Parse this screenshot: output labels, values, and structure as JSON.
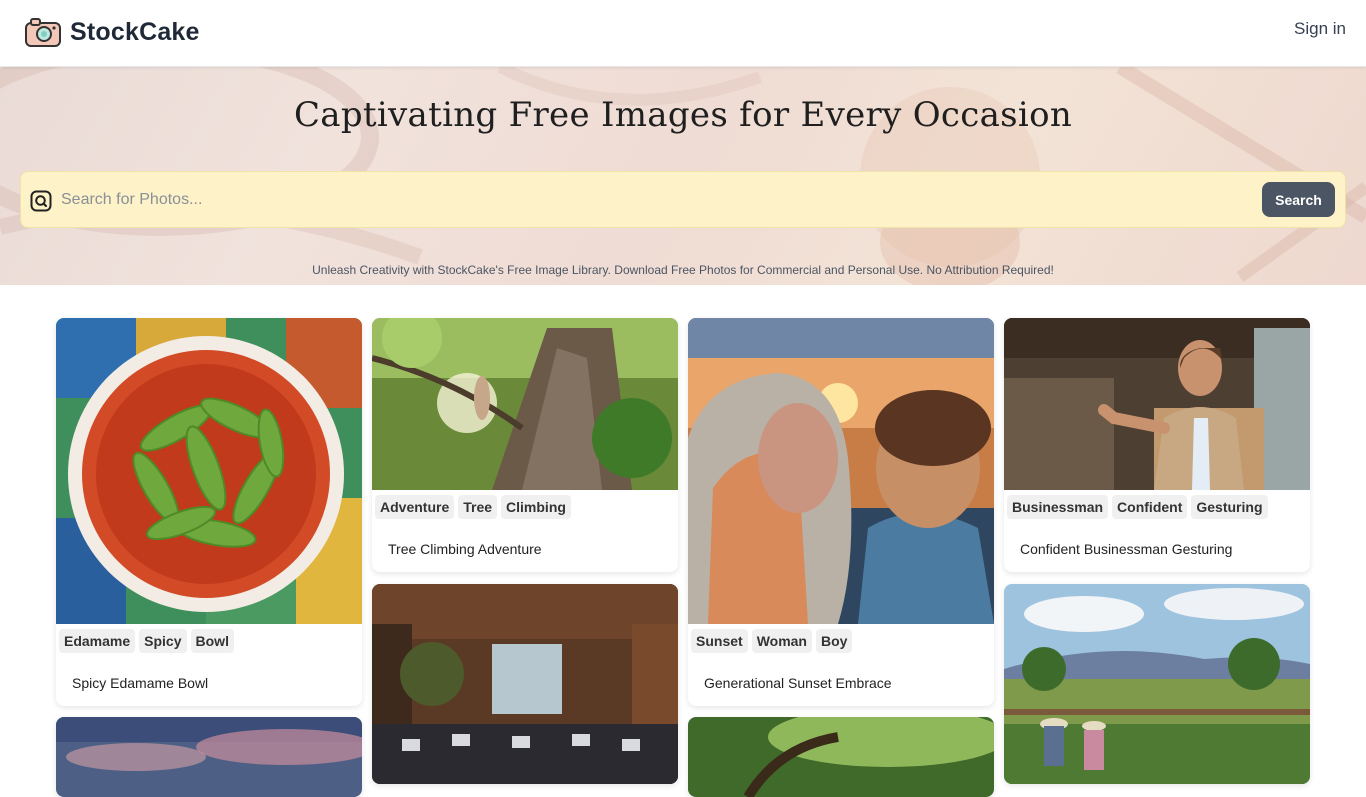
{
  "header": {
    "logo_text": "StockCake",
    "signin_label": "Sign in"
  },
  "hero": {
    "title": "Captivating Free Images for Every Occasion",
    "search": {
      "placeholder": "Search for Photos...",
      "value": "",
      "button_label": "Search"
    },
    "tagline": "Unleash Creativity with StockCake's Free Image Library. Download Free Photos for Commercial and Personal Use. No Attribution Required!"
  },
  "cards": [
    {
      "tags": [
        "Edamame",
        "Spicy",
        "Bowl"
      ],
      "caption": "Spicy Edamame Bowl"
    },
    {
      "tags": [
        "Adventure",
        "Tree",
        "Climbing"
      ],
      "caption": "Tree Climbing Adventure"
    },
    {
      "tags": [
        "Sunset",
        "Woman",
        "Boy"
      ],
      "caption": "Generational Sunset Embrace"
    },
    {
      "tags": [
        "Businessman",
        "Confident",
        "Gesturing"
      ],
      "caption": "Confident Businessman Gesturing"
    }
  ],
  "colors": {
    "accent_button": "#4b5563",
    "search_bg": "#fdf2c8",
    "tag_bg": "#f0f0f0"
  }
}
